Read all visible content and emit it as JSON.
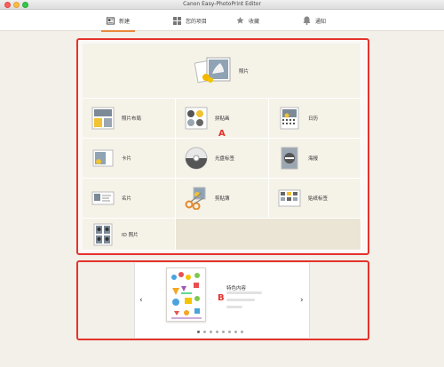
{
  "window": {
    "title": "Canon Easy-PhotoPrint Editor"
  },
  "nav": {
    "tabs": [
      {
        "label": "新建",
        "icon": "new-icon"
      },
      {
        "label": "您的项目",
        "icon": "grid-icon"
      },
      {
        "label": "收藏",
        "icon": "star-icon"
      },
      {
        "label": "通知",
        "icon": "bell-icon"
      }
    ]
  },
  "menu": {
    "photo": "照片",
    "items": [
      {
        "label": "照片布局",
        "icon": "photo-layout-icon"
      },
      {
        "label": "拼贴画",
        "icon": "collage-icon"
      },
      {
        "label": "日历",
        "icon": "calendar-icon"
      },
      {
        "label": "卡片",
        "icon": "card-icon"
      },
      {
        "label": "光盘标签",
        "icon": "disc-icon"
      },
      {
        "label": "海报",
        "icon": "poster-icon"
      },
      {
        "label": "名片",
        "icon": "business-card-icon"
      },
      {
        "label": "剪贴簿",
        "icon": "scissors-icon"
      },
      {
        "label": "贴纸标签",
        "icon": "sticker-icon"
      },
      {
        "label": "ID 照片",
        "icon": "id-photo-icon"
      }
    ]
  },
  "callouts": {
    "a": "A",
    "b": "B"
  },
  "featured": {
    "title": "特色内容",
    "prev": "‹",
    "next": "›",
    "dots": 8,
    "active_dot": 0
  }
}
